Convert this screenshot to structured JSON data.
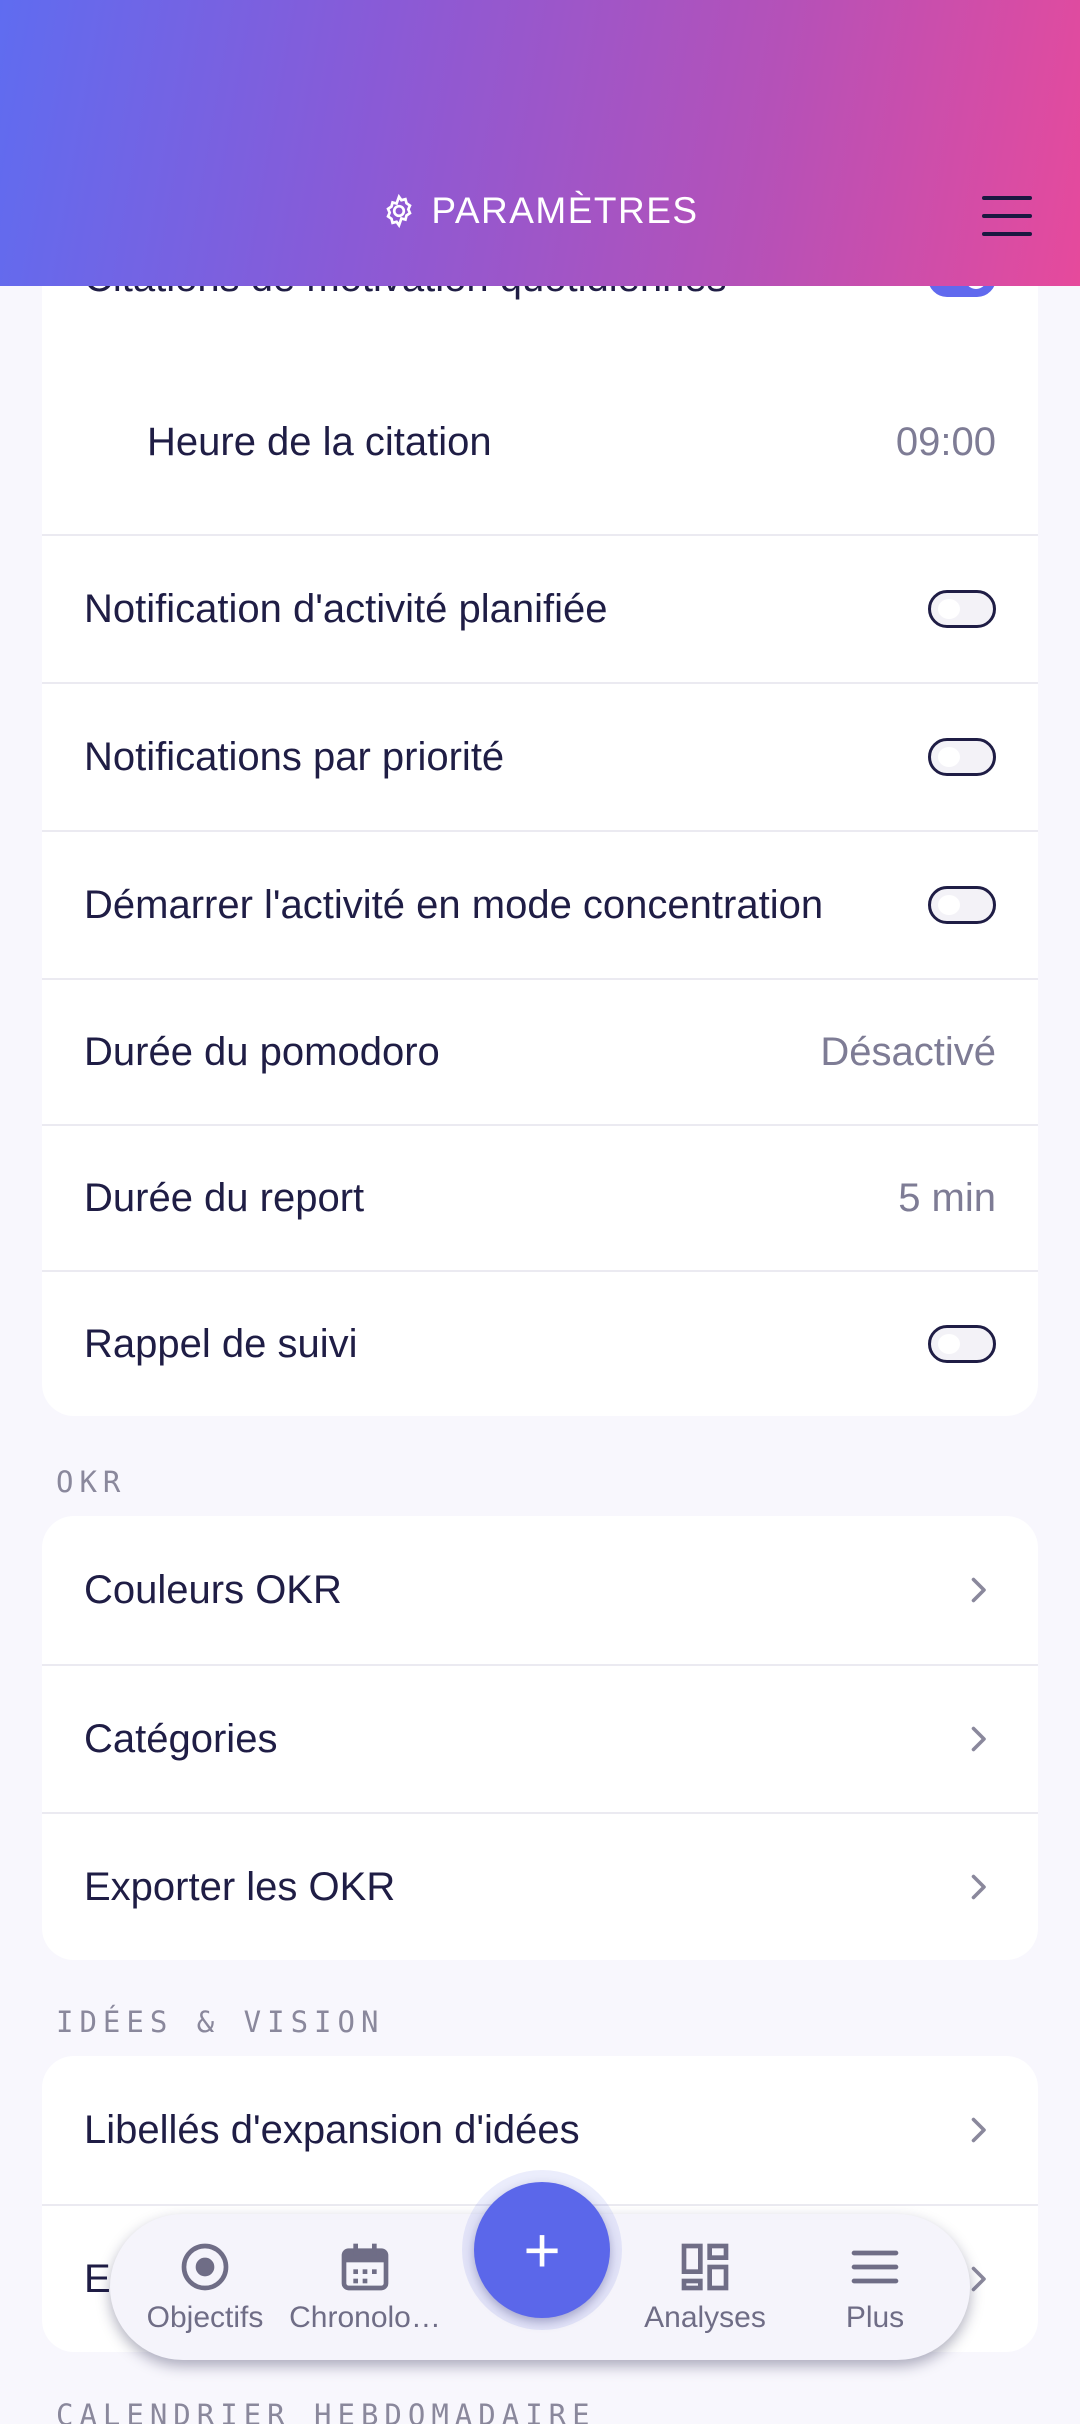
{
  "header": {
    "title": "PARAMÈTRES",
    "gear_icon": "gear-icon",
    "menu_icon": "hamburger-menu-icon"
  },
  "notifications": {
    "items": [
      {
        "label": "Citations de motivation quotidiennes",
        "type": "toggle",
        "on": true
      },
      {
        "label": "Heure de la citation",
        "type": "value",
        "value": "09:00"
      },
      {
        "label": "Notification d'activité planifiée",
        "type": "toggle",
        "on": false
      },
      {
        "label": "Notifications par priorité",
        "type": "toggle",
        "on": false
      },
      {
        "label": "Démarrer l'activité en mode concentration",
        "type": "toggle",
        "on": false
      },
      {
        "label": "Durée du pomodoro",
        "type": "value",
        "value": "Désactivé"
      },
      {
        "label": "Durée du report",
        "type": "value",
        "value": "5 min"
      },
      {
        "label": "Rappel de suivi",
        "type": "toggle",
        "on": false
      }
    ]
  },
  "okr": {
    "section_label": "OKR",
    "items": [
      {
        "label": "Couleurs OKR"
      },
      {
        "label": "Catégories"
      },
      {
        "label": "Exporter les OKR"
      }
    ]
  },
  "ideas": {
    "section_label": "IDÉES & VISION",
    "items": [
      {
        "label": "Libellés d'expansion d'idées"
      },
      {
        "label": "E"
      }
    ]
  },
  "calendar": {
    "section_label": "CALENDRIER HEBDOMADAIRE"
  },
  "bottom_nav": {
    "items": [
      {
        "label": "Objectifs",
        "icon": "target-icon"
      },
      {
        "label": "Chronolo…",
        "icon": "calendar-icon"
      },
      {
        "label": "Analyses",
        "icon": "dashboard-icon"
      },
      {
        "label": "Plus",
        "icon": "menu-icon"
      }
    ],
    "fab_label": "+"
  },
  "colors": {
    "accent": "#5b67ea",
    "text": "#1f1d45",
    "muted": "#7e7c95",
    "background": "#f8f7fd"
  }
}
